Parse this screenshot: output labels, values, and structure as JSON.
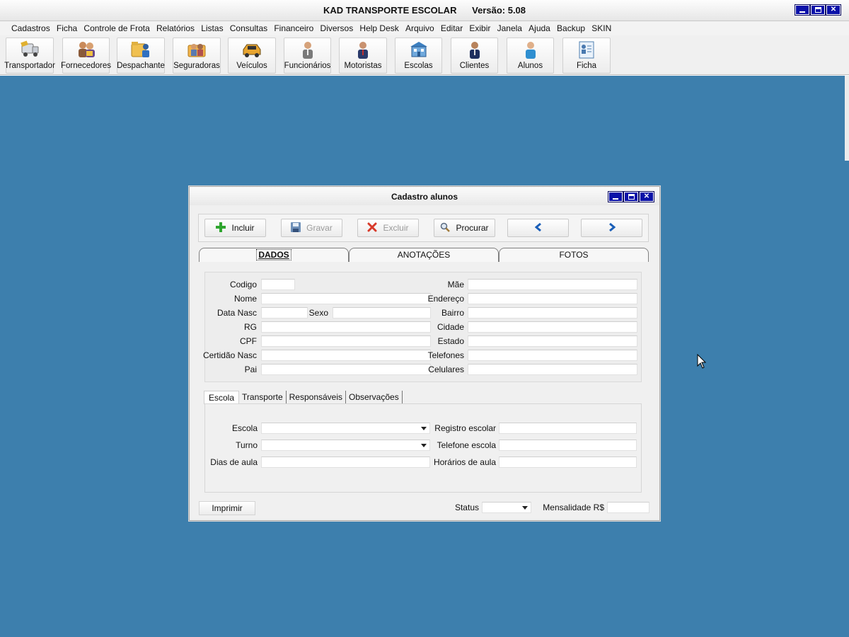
{
  "window": {
    "title": "KAD TRANSPORTE ESCOLAR      Versão: 5.08"
  },
  "menu": [
    "Cadastros",
    "Ficha",
    "Controle de Frota",
    "Relatórios",
    "Listas",
    "Consultas",
    "Financeiro",
    "Diversos",
    "Help Desk",
    "Arquivo",
    "Editar",
    "Exibir",
    "Janela",
    "Ajuda",
    "Backup",
    "SKIN"
  ],
  "toolbar": {
    "transportador": "Transportador",
    "fornecedores": "Fornecedores",
    "despachante": "Despachante",
    "seguradoras": "Seguradoras",
    "veiculos": "Veículos",
    "funcionarios": "Funcionários",
    "motoristas": "Motoristas",
    "escolas": "Escolas",
    "clientes": "Clientes",
    "alunos": "Alunos",
    "ficha": "Ficha"
  },
  "dialog": {
    "title": "Cadastro alunos",
    "buttons": {
      "incluir": "Incluir",
      "gravar": "Gravar",
      "excluir": "Excluir",
      "procurar": "Procurar"
    },
    "tabs": {
      "dados": "DADOS",
      "anotacoes": "ANOTAÇÕES",
      "fotos": "FOTOS"
    },
    "fields": {
      "codigo": "Codigo",
      "nome": "Nome",
      "data_nasc": "Data Nasc",
      "sexo": "Sexo",
      "rg": "RG",
      "cpf": "CPF",
      "certidao_nasc": "Certidão Nasc",
      "pai": "Pai",
      "mae": "Mãe",
      "endereco": "Endereço",
      "bairro": "Bairro",
      "cidade": "Cidade",
      "estado": "Estado",
      "telefones": "Telefones",
      "celulares": "Celulares"
    },
    "subtabs": {
      "escola": "Escola",
      "transporte": "Transporte",
      "responsaveis": "Responsáveis",
      "observacoes": "Observações"
    },
    "escola_fields": {
      "escola": "Escola",
      "turno": "Turno",
      "dias_aula": "Dias de aula",
      "registro_escolar": "Registro escolar",
      "telefone_escola": "Telefone escola",
      "horarios_aula": "Horários de aula"
    },
    "footer": {
      "imprimir": "Imprimir",
      "status": "Status",
      "mensalidade": "Mensalidade R$"
    }
  },
  "colors": {
    "desktop": "#3d7fad",
    "title_button": "#0a11a8"
  }
}
